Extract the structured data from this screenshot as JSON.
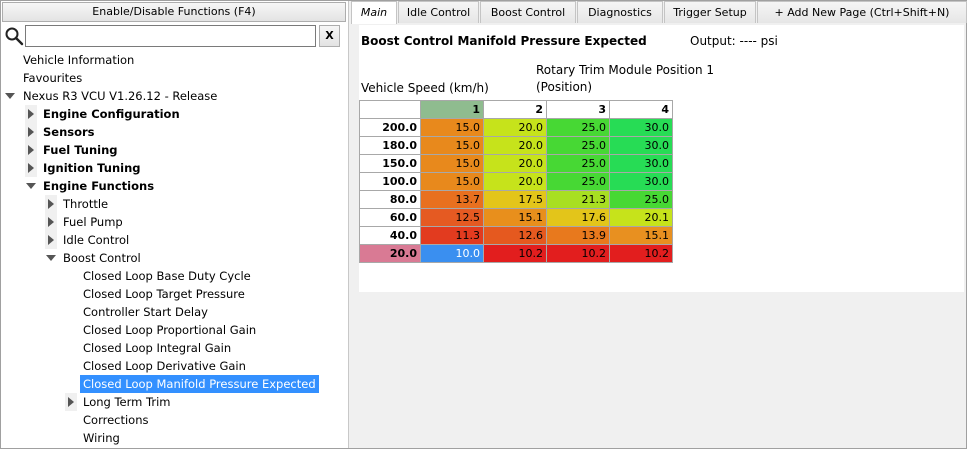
{
  "left_panel": {
    "toggle_button": "Enable/Disable Functions (F4)",
    "search": {
      "value": "",
      "placeholder": ""
    },
    "clear_button": "X",
    "tree": [
      {
        "label": "Vehicle Information",
        "indent": 0,
        "arrow": "none",
        "bold": false
      },
      {
        "label": "Favourites",
        "indent": 0,
        "arrow": "none",
        "bold": false
      },
      {
        "label": "Nexus R3 VCU V1.26.12 - Release",
        "indent": 0,
        "arrow": "down",
        "bold": false,
        "expander": true
      },
      {
        "label": "Engine Configuration",
        "indent": 1,
        "arrow": "right",
        "bold": true
      },
      {
        "label": "Sensors",
        "indent": 1,
        "arrow": "right",
        "bold": true
      },
      {
        "label": "Fuel Tuning",
        "indent": 1,
        "arrow": "right",
        "bold": true
      },
      {
        "label": "Ignition Tuning",
        "indent": 1,
        "arrow": "right",
        "bold": true
      },
      {
        "label": "Engine Functions",
        "indent": 1,
        "arrow": "down",
        "bold": true
      },
      {
        "label": "Throttle",
        "indent": 2,
        "arrow": "right",
        "bold": false
      },
      {
        "label": "Fuel Pump",
        "indent": 2,
        "arrow": "right",
        "bold": false
      },
      {
        "label": "Idle Control",
        "indent": 2,
        "arrow": "right",
        "bold": false
      },
      {
        "label": "Boost Control",
        "indent": 2,
        "arrow": "down",
        "bold": false
      },
      {
        "label": "Closed Loop Base Duty Cycle",
        "indent": 3,
        "arrow": "none",
        "bold": false
      },
      {
        "label": "Closed Loop Target Pressure",
        "indent": 3,
        "arrow": "none",
        "bold": false
      },
      {
        "label": "Controller Start Delay",
        "indent": 3,
        "arrow": "none",
        "bold": false
      },
      {
        "label": "Closed Loop Proportional Gain",
        "indent": 3,
        "arrow": "none",
        "bold": false
      },
      {
        "label": "Closed Loop Integral Gain",
        "indent": 3,
        "arrow": "none",
        "bold": false
      },
      {
        "label": "Closed Loop Derivative Gain",
        "indent": 3,
        "arrow": "none",
        "bold": false
      },
      {
        "label": "Closed Loop Manifold Pressure Expected",
        "indent": 3,
        "arrow": "none",
        "bold": false,
        "selected": true
      },
      {
        "label": "Long Term Trim",
        "indent": 3,
        "arrow": "right",
        "bold": false,
        "arrow_offset": true
      },
      {
        "label": "Corrections",
        "indent": 3,
        "arrow": "none",
        "bold": false
      },
      {
        "label": "Wiring",
        "indent": 3,
        "arrow": "none",
        "bold": false
      }
    ]
  },
  "tabs": [
    {
      "label": "Main",
      "active": true
    },
    {
      "label": "Idle Control",
      "active": false
    },
    {
      "label": "Boost Control",
      "active": false
    },
    {
      "label": "Diagnostics",
      "active": false
    },
    {
      "label": "Trigger Setup",
      "active": false
    },
    {
      "label": "+ Add New Page (Ctrl+Shift+N)",
      "active": false
    }
  ],
  "table_view": {
    "title": "Boost Control Manifold Pressure Expected",
    "output": "Output: ---- psi",
    "row_axis_label": "Vehicle Speed (km/h)",
    "col_axis_label_line1": "Rotary Trim Module Position 1",
    "col_axis_label_line2": "(Position)",
    "columns": [
      "1",
      "2",
      "3",
      "4"
    ],
    "highlight_column": 0,
    "highlight_row": 7,
    "highlight_row_color": "#d97a94",
    "highlight_col_color": "#8fbc8f",
    "rows": [
      {
        "label": "200.0",
        "values": [
          "15.0",
          "20.0",
          "25.0",
          "30.0"
        ]
      },
      {
        "label": "180.0",
        "values": [
          "15.0",
          "20.0",
          "25.0",
          "30.0"
        ]
      },
      {
        "label": "150.0",
        "values": [
          "15.0",
          "20.0",
          "25.0",
          "30.0"
        ]
      },
      {
        "label": "100.0",
        "values": [
          "15.0",
          "20.0",
          "25.0",
          "30.0"
        ]
      },
      {
        "label": "80.0",
        "values": [
          "13.7",
          "17.5",
          "21.3",
          "25.0"
        ]
      },
      {
        "label": "60.0",
        "values": [
          "12.5",
          "15.1",
          "17.6",
          "20.1"
        ]
      },
      {
        "label": "40.0",
        "values": [
          "11.3",
          "12.6",
          "13.9",
          "15.1"
        ]
      },
      {
        "label": "20.0",
        "values": [
          "10.0",
          "10.2",
          "10.2",
          "10.2"
        ]
      }
    ],
    "cell_colors": [
      [
        "#e8891c",
        "#c6e31b",
        "#47d834",
        "#27dc55"
      ],
      [
        "#e8891c",
        "#c6e31b",
        "#47d834",
        "#27dc55"
      ],
      [
        "#e8891c",
        "#c6e31b",
        "#47d834",
        "#27dc55"
      ],
      [
        "#e8891c",
        "#c6e31b",
        "#47d834",
        "#27dc55"
      ],
      [
        "#e8701f",
        "#e3c51a",
        "#a8df22",
        "#47d834"
      ],
      [
        "#e55a22",
        "#e88f1c",
        "#e3c51a",
        "#c6e31b"
      ],
      [
        "#e23b1f",
        "#e5591f",
        "#e8791d",
        "#e89020"
      ],
      [
        "#3a8ff0",
        "#e21e1e",
        "#e21e1e",
        "#e21e1e"
      ]
    ]
  }
}
